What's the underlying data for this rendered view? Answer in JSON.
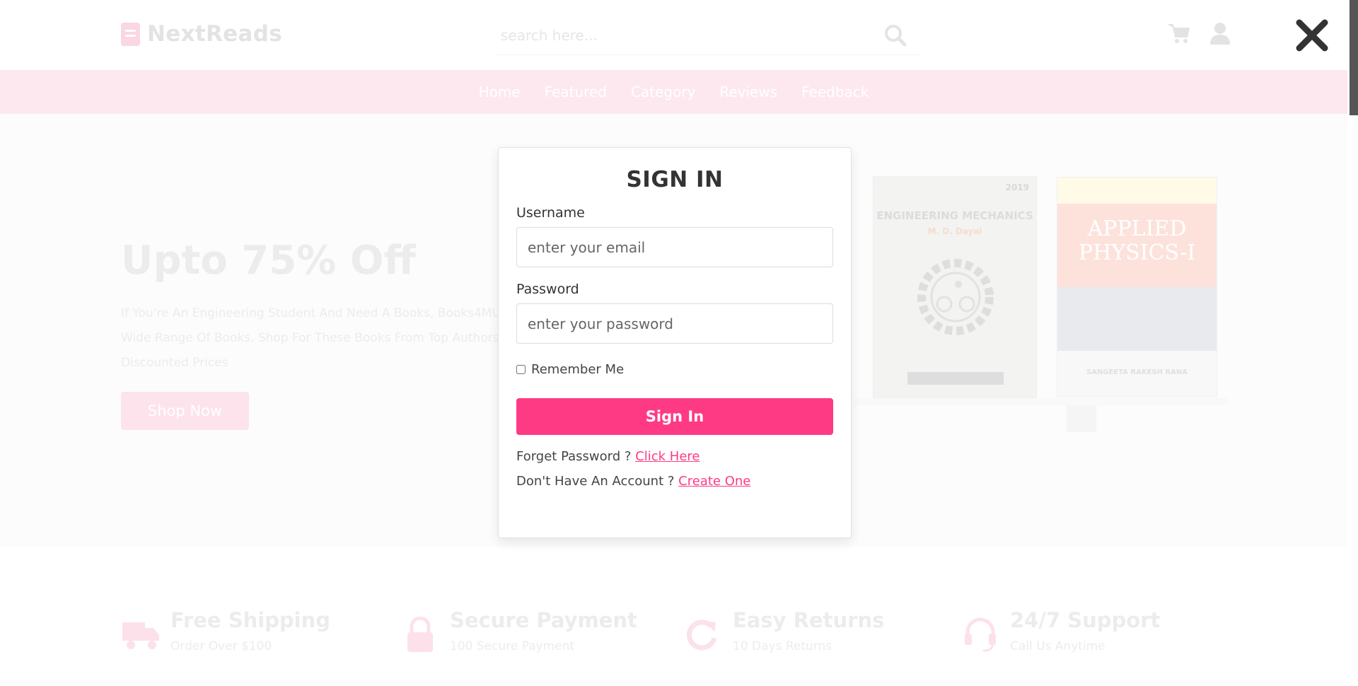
{
  "header": {
    "logo_text": "NextReads",
    "search_placeholder": "search here...",
    "icons": [
      "shopping-cart-icon",
      "user-icon"
    ]
  },
  "nav": {
    "items": [
      "Home",
      "Featured",
      "Category",
      "Reviews",
      "Feedback"
    ]
  },
  "hero": {
    "title": "Upto 75% Off",
    "description": "If You're An Engineering Student And Need A Books, Books4MU Wide Range Of Books. Shop For These Books From Top Authors Discounted Prices",
    "button_label": "Shop Now",
    "books": [
      {
        "year": "2019",
        "title": "ENGINEERING MECHANICS",
        "author": "M. D. Dayal"
      },
      {
        "title": "APPLIED PHYSICS-I",
        "author": "SANGEETA RAKESH RANA"
      }
    ]
  },
  "features": [
    {
      "title": "Free Shipping",
      "subtitle": "Order Over $100",
      "icon": "truck-icon"
    },
    {
      "title": "Secure Payment",
      "subtitle": "100 Secure Payment",
      "icon": "lock-icon"
    },
    {
      "title": "Easy Returns",
      "subtitle": "10 Days Returns",
      "icon": "redo-icon"
    },
    {
      "title": "24/7 Support",
      "subtitle": "Call Us Anytime",
      "icon": "headset-icon"
    }
  ],
  "modal": {
    "title": "SIGN IN",
    "username_label": "Username",
    "username_placeholder": "enter your email",
    "password_label": "Password",
    "password_placeholder": "enter your password",
    "remember_label": "Remember Me",
    "remember_checked": false,
    "submit_label": "Sign In",
    "forgot_text": "Forget Password ?",
    "forgot_link": "Click Here",
    "signup_text": "Don't Have An Account ?",
    "signup_link": "Create One"
  },
  "colors": {
    "accent": "#ff3a84",
    "nav_bg": "#fde8ef",
    "close_icon": "#333333"
  }
}
